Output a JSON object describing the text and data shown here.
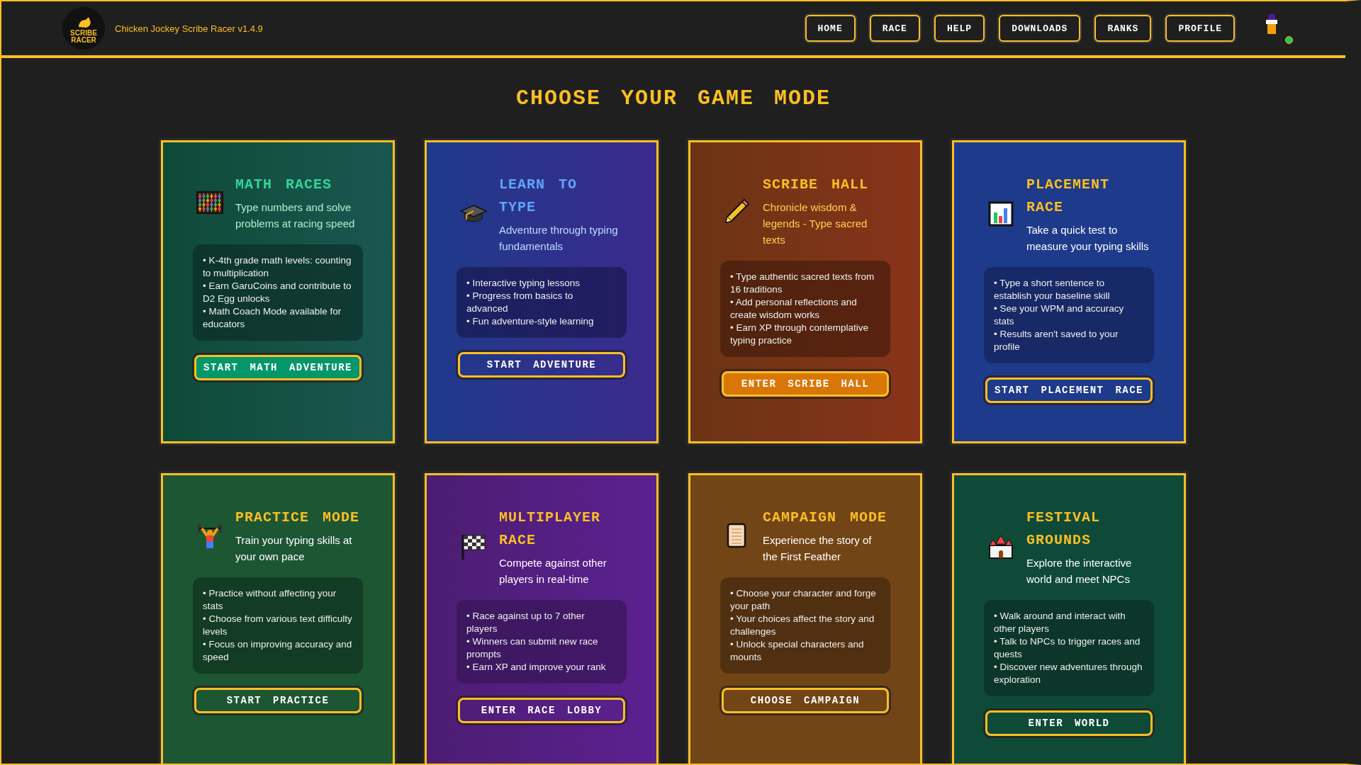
{
  "header": {
    "logo_text": "SCRIBE RACER",
    "title": "Chicken Jockey Scribe Racer v1.4.9",
    "nav": [
      "HOME",
      "RACE",
      "HELP",
      "DOWNLOADS",
      "RANKS",
      "PROFILE"
    ],
    "online": true
  },
  "heading": "CHOOSE YOUR GAME MODE",
  "modes": [
    {
      "kind": "math",
      "title": "MATH RACES",
      "description": "Type numbers and solve problems at racing speed",
      "features": [
        "• K-4th grade math levels: counting to multiplication",
        "• Earn GaruCoins and contribute to D2 Egg unlocks",
        "• Math Coach Mode available for educators"
      ],
      "button": "START MATH ADVENTURE"
    },
    {
      "kind": "learn",
      "title": "LEARN TO TYPE",
      "description": "Adventure through typing fundamentals",
      "features": [
        "• Interactive typing lessons",
        "• Progress from basics to advanced",
        "• Fun adventure-style learning"
      ],
      "button": "START ADVENTURE"
    },
    {
      "kind": "scribe",
      "title": "SCRIBE HALL",
      "description": "Chronicle wisdom & legends - Type sacred texts",
      "features": [
        "• Type authentic sacred texts from 16 traditions",
        "• Add personal reflections and create wisdom works",
        "• Earn XP through contemplative typing practice"
      ],
      "button": "ENTER SCRIBE HALL"
    },
    {
      "kind": "placement",
      "title": "PLACEMENT RACE",
      "description": "Take a quick test to measure your typing skills",
      "features": [
        "• Type a short sentence to establish your baseline skill",
        "• See your WPM and accuracy stats",
        "• Results aren't saved to your profile"
      ],
      "button": "START PLACEMENT RACE"
    },
    {
      "kind": "practice",
      "title": "PRACTICE MODE",
      "description": "Train your typing skills at your own pace",
      "features": [
        "• Practice without affecting your stats",
        "• Choose from various text difficulty levels",
        "• Focus on improving accuracy and speed"
      ],
      "button": "START PRACTICE"
    },
    {
      "kind": "multiplayer",
      "title": "MULTIPLAYER RACE",
      "description": "Compete against other players in real-time",
      "features": [
        "• Race against up to 7 other players",
        "• Winners can submit new race prompts",
        "• Earn XP and improve your rank"
      ],
      "button": "ENTER RACE LOBBY"
    },
    {
      "kind": "campaign",
      "title": "CAMPAIGN MODE",
      "description": "Experience the story of the First Feather",
      "features": [
        "• Choose your character and forge your path",
        "• Your choices affect the story and challenges",
        "• Unlock special characters and mounts"
      ],
      "button": "CHOOSE CAMPAIGN"
    },
    {
      "kind": "festival",
      "title": "FESTIVAL GROUNDS",
      "description": "Explore the interactive world and meet NPCs",
      "features": [
        "• Walk around and interact with other players",
        "• Talk to NPCs to trigger races and quests",
        "• Discover new adventures through exploration"
      ],
      "button": "ENTER WORLD"
    }
  ]
}
